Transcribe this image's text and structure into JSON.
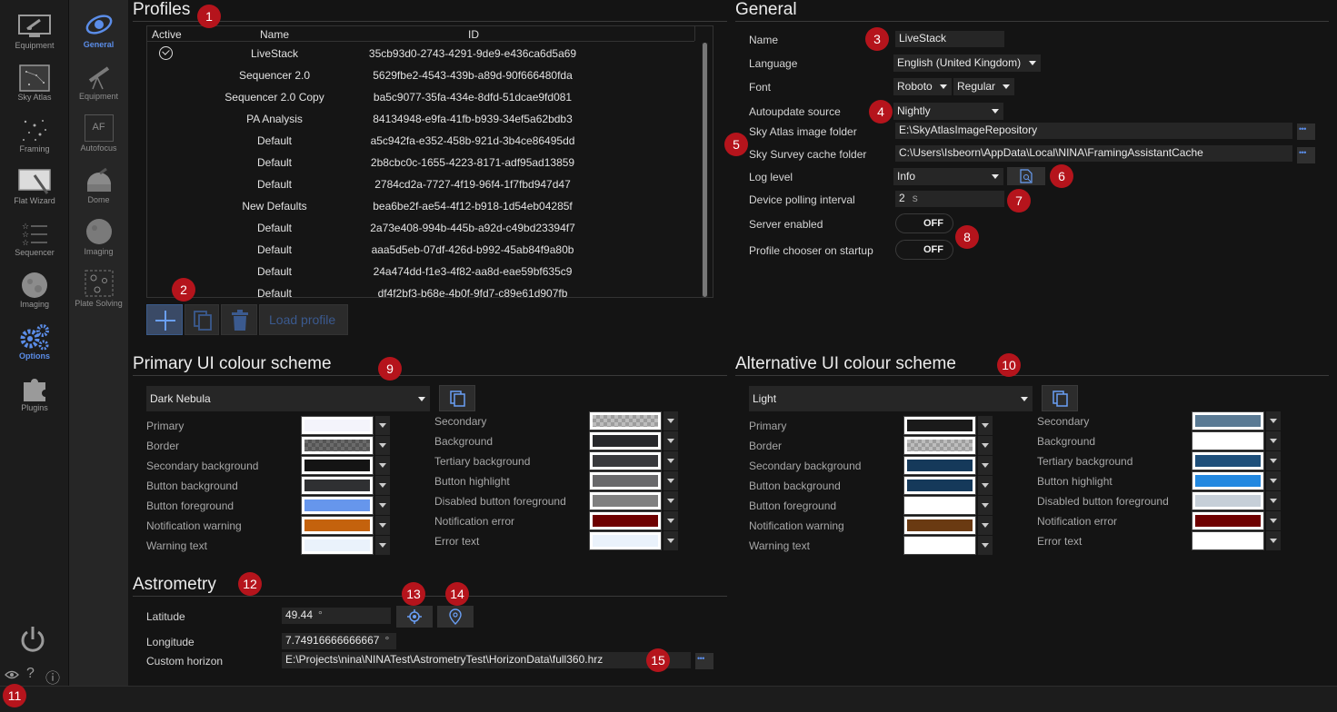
{
  "nav": {
    "items": [
      {
        "label": "Equipment",
        "icon": "telescope-screen-icon"
      },
      {
        "label": "Sky Atlas",
        "icon": "sky-map-icon"
      },
      {
        "label": "Framing",
        "icon": "framing-stars-icon"
      },
      {
        "label": "Flat Wizard",
        "icon": "flat-wizard-icon"
      },
      {
        "label": "Sequencer",
        "icon": "sequencer-list-icon"
      },
      {
        "label": "Imaging",
        "icon": "imaging-moon-icon"
      },
      {
        "label": "Options",
        "icon": "gears-icon"
      },
      {
        "label": "Plugins",
        "icon": "puzzle-icon"
      }
    ],
    "active": "Options"
  },
  "subnav": {
    "items": [
      {
        "label": "General",
        "icon": "general-galaxy-icon"
      },
      {
        "label": "Equipment",
        "icon": "telescope-icon"
      },
      {
        "label": "Autofocus",
        "icon": "autofocus-af-icon"
      },
      {
        "label": "Dome",
        "icon": "dome-icon"
      },
      {
        "label": "Imaging",
        "icon": "imaging-icon"
      },
      {
        "label": "Plate Solving",
        "icon": "plate-solving-icon"
      }
    ],
    "af_text": "AF",
    "active": "General"
  },
  "profiles": {
    "title": "Profiles",
    "headers": {
      "active": "Active",
      "name": "Name",
      "id": "ID"
    },
    "rows": [
      {
        "active": true,
        "name": "LiveStack",
        "id": "35cb93d0-2743-4291-9de9-e436ca6d5a69"
      },
      {
        "active": false,
        "name": "Sequencer 2.0",
        "id": "5629fbe2-4543-439b-a89d-90f666480fda"
      },
      {
        "active": false,
        "name": "Sequencer 2.0 Copy",
        "id": "ba5c9077-35fa-434e-8dfd-51dcae9fd081"
      },
      {
        "active": false,
        "name": "PA Analysis",
        "id": "84134948-e9fa-41fb-b939-34ef5a62bdb3"
      },
      {
        "active": false,
        "name": "Default",
        "id": "a5c942fa-e352-458b-921d-3b4ce86495dd"
      },
      {
        "active": false,
        "name": "Default",
        "id": "2b8cbc0c-1655-4223-8171-adf95ad13859"
      },
      {
        "active": false,
        "name": "Default",
        "id": "2784cd2a-7727-4f19-96f4-1f7fbd947d47"
      },
      {
        "active": false,
        "name": "New Defaults",
        "id": "bea6be2f-ae54-4f12-b918-1d54eb04285f"
      },
      {
        "active": false,
        "name": "Default",
        "id": "2a73e408-994b-445b-a92d-c49bd23394f7"
      },
      {
        "active": false,
        "name": "Default",
        "id": "aaa5d5eb-07df-426d-b992-45ab84f9a80b"
      },
      {
        "active": false,
        "name": "Default",
        "id": "24a474dd-f1e3-4f82-aa8d-eae59bf635c9"
      },
      {
        "active": false,
        "name": "Default",
        "id": "df4f2bf3-b68e-4b0f-9fd7-c89e61d907fb"
      }
    ],
    "load_label": "Load profile"
  },
  "general": {
    "title": "General",
    "name_label": "Name",
    "name_value": "LiveStack",
    "language_label": "Language",
    "language_value": "English (United Kingdom)",
    "font_label": "Font",
    "font_value": "Roboto",
    "font_style_value": "Regular",
    "autoupdate_label": "Autoupdate source",
    "autoupdate_value": "Nightly",
    "skyatlas_label": "Sky Atlas image folder",
    "skyatlas_value": "E:\\SkyAtlasImageRepository",
    "skysurvey_label": "Sky Survey cache folder",
    "skysurvey_value": "C:\\Users\\Isbeorn\\AppData\\Local\\NINA\\FramingAssistantCache",
    "loglevel_label": "Log level",
    "loglevel_value": "Info",
    "polling_label": "Device polling interval",
    "polling_value": "2",
    "polling_unit": "s",
    "server_label": "Server enabled",
    "server_value": "OFF",
    "chooser_label": "Profile chooser on startup",
    "chooser_value": "OFF"
  },
  "primary_scheme": {
    "title": "Primary UI colour scheme",
    "selected": "Dark Nebula",
    "left": [
      {
        "label": "Primary",
        "color": "#f4f4fb"
      },
      {
        "label": "Border",
        "color": "checker-dark"
      },
      {
        "label": "Secondary background",
        "color": "#141414"
      },
      {
        "label": "Button background",
        "color": "#2f3032"
      },
      {
        "label": "Button foreground",
        "color": "#6696ec"
      },
      {
        "label": "Notification warning",
        "color": "#c4620d"
      },
      {
        "label": "Warning text",
        "color": "#eaf2fb"
      }
    ],
    "right": [
      {
        "label": "Secondary",
        "color": "checker"
      },
      {
        "label": "Background",
        "color": "#27282b"
      },
      {
        "label": "Tertiary background",
        "color": "#38393c"
      },
      {
        "label": "Button highlight",
        "color": "#69696b"
      },
      {
        "label": "Disabled button foreground",
        "color": "#808080"
      },
      {
        "label": "Notification error",
        "color": "#6e0000"
      },
      {
        "label": "Error text",
        "color": "#eaf2fb"
      }
    ]
  },
  "alt_scheme": {
    "title": "Alternative UI colour scheme",
    "selected": "Light",
    "left": [
      {
        "label": "Primary",
        "color": "#1a1a1a"
      },
      {
        "label": "Border",
        "color": "checker"
      },
      {
        "label": "Secondary background",
        "color": "#15395a"
      },
      {
        "label": "Button background",
        "color": "#15395a"
      },
      {
        "label": "Button foreground",
        "color": "#ffffff"
      },
      {
        "label": "Notification warning",
        "color": "#6a3a12"
      },
      {
        "label": "Warning text",
        "color": "#ffffff"
      }
    ],
    "right": [
      {
        "label": "Secondary",
        "color": "#5a7a94"
      },
      {
        "label": "Background",
        "color": "#ffffff"
      },
      {
        "label": "Tertiary background",
        "color": "#1e4f7a"
      },
      {
        "label": "Button highlight",
        "color": "#2288e0"
      },
      {
        "label": "Disabled button foreground",
        "color": "#c6cfd8"
      },
      {
        "label": "Notification error",
        "color": "#6e0000"
      },
      {
        "label": "Error text",
        "color": "#ffffff"
      }
    ]
  },
  "astrometry": {
    "title": "Astrometry",
    "latitude_label": "Latitude",
    "latitude_value": "49.44",
    "latitude_unit": "°",
    "longitude_label": "Longitude",
    "longitude_value": "7.74916666666667",
    "longitude_unit": "°",
    "horizon_label": "Custom horizon",
    "horizon_value": "E:\\Projects\\nina\\NINATest\\AstrometryTest\\HorizonData\\full360.hrz"
  },
  "badges": [
    "1",
    "2",
    "3",
    "4",
    "5",
    "6",
    "7",
    "8",
    "9",
    "10",
    "11",
    "12",
    "13",
    "14",
    "15"
  ],
  "bottom": {
    "help": "?",
    "info": "ⓘ"
  },
  "colors": {
    "accent": "#5b8de8",
    "badge": "#b5141c"
  }
}
